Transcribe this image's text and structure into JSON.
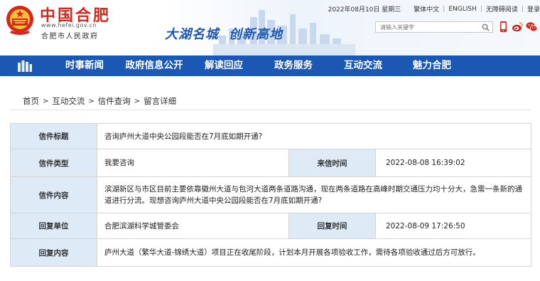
{
  "header": {
    "site_title": "中国合肥",
    "site_url": "www.hefei.gov.cn",
    "site_org": "合肥市人民政府",
    "slogan_part1": "大湖名城",
    "slogan_part2": "创新高地",
    "date": "2022年08月10日 星期三",
    "links": [
      "繁体中文",
      "ENGLISH",
      "无障碍阅读",
      "登录"
    ],
    "search_placeholder": "请输入关键字",
    "icons": [
      "search-icon",
      "mobile-icon",
      "weibo-icon",
      "wechat-icon"
    ]
  },
  "nav": {
    "home_icon": "home-icon",
    "items": [
      "时事新闻",
      "政府信息公开",
      "解读回应",
      "政务服务",
      "互动交流",
      "魅力合肥"
    ]
  },
  "breadcrumb": [
    "首页",
    "互动交流",
    "信件查询",
    "留言详细"
  ],
  "letter": {
    "title_label": "信件标题",
    "title_value": "咨询庐州大道中央公园段能否在7月底如期开通?",
    "type_label": "信件类型",
    "type_value": "我要咨询",
    "date_label": "来信时间",
    "date_value": "2022-08-08 16:39:02",
    "content_label": "信件内容",
    "content_value": "滨湖新区与市区目前主要依靠徽州大道与包河大道两条道路沟通，现在两条道路在高峰时期交通压力均十分大，急需一条新的通道进行分流。现想咨询庐州大道中央公园段能否在7月底如期开通?",
    "reply_unit_label": "回复单位",
    "reply_unit_value": "合肥滨湖科学城管委会",
    "reply_time_label": "回复时间",
    "reply_time_value": "2022-08-09 17:26:50",
    "reply_content_label": "回复内容",
    "reply_content_value": "庐州大道（繁华大道-锦绣大道）项目正在收尾阶段，计划本月开展各项验收工作，需待各项验收通过后方可放行。"
  },
  "colors": {
    "brand_red": "#d7261c",
    "nav_blue": "#1a58b3",
    "label_bg": "#dfeaf7"
  }
}
